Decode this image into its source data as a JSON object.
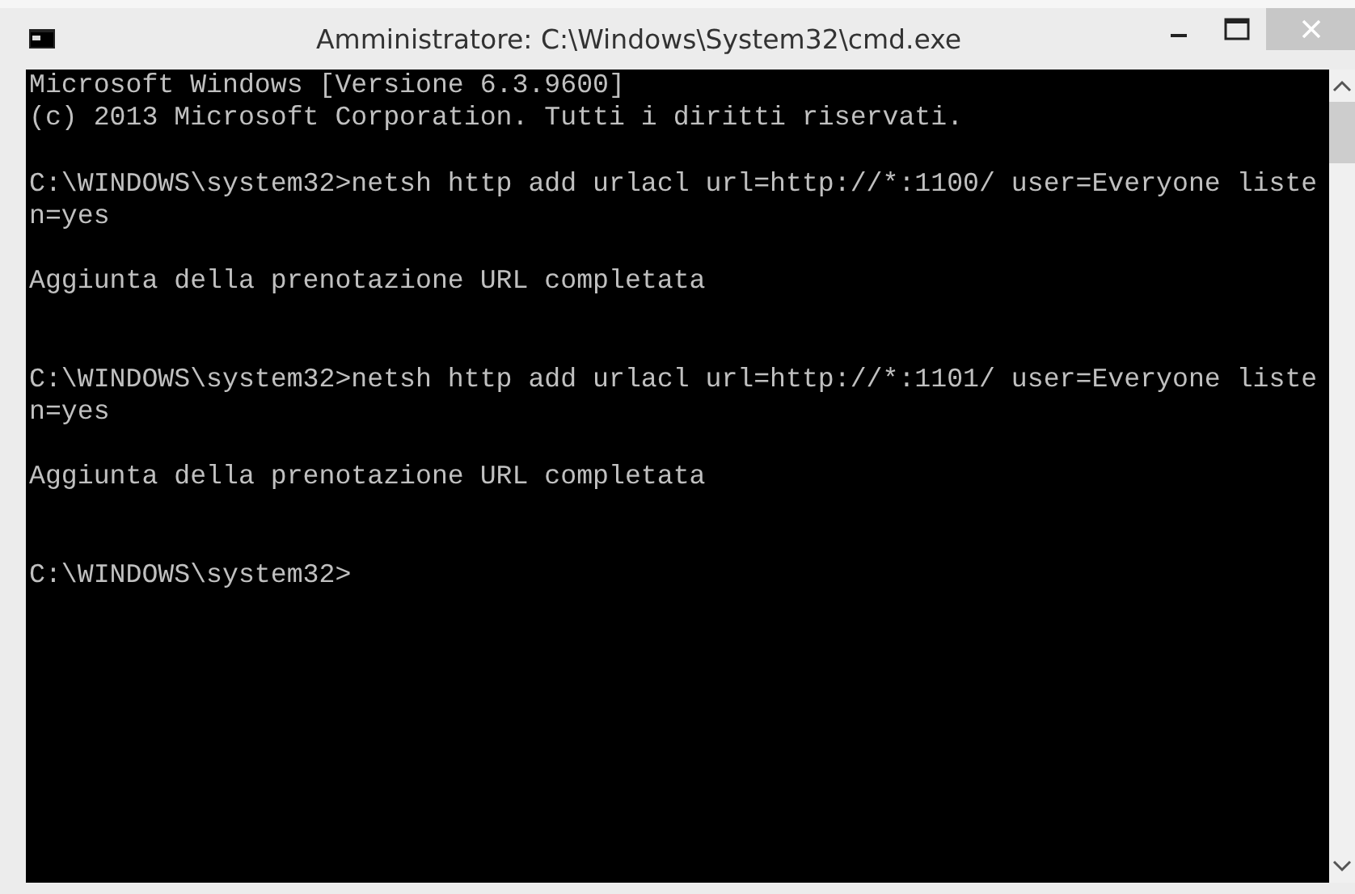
{
  "window": {
    "title": "Amministratore: C:\\Windows\\System32\\cmd.exe"
  },
  "console": {
    "blocks": [
      {
        "kind": "output",
        "lines": [
          "Microsoft Windows [Versione 6.3.9600]",
          "(c) 2013 Microsoft Corporation. Tutti i diritti riservati."
        ]
      },
      {
        "kind": "command",
        "lines": [
          "C:\\WINDOWS\\system32>netsh http add urlacl url=http://*:1100/ user=Everyone listen=yes"
        ]
      },
      {
        "kind": "result",
        "lines": [
          "Aggiunta della prenotazione URL completata"
        ]
      },
      {
        "kind": "command",
        "lines": [
          "C:\\WINDOWS\\system32>netsh http add urlacl url=http://*:1101/ user=Everyone listen=yes"
        ]
      },
      {
        "kind": "result",
        "lines": [
          "Aggiunta della prenotazione URL completata"
        ]
      },
      {
        "kind": "prompt",
        "lines": [
          "C:\\WINDOWS\\system32>"
        ]
      }
    ]
  }
}
